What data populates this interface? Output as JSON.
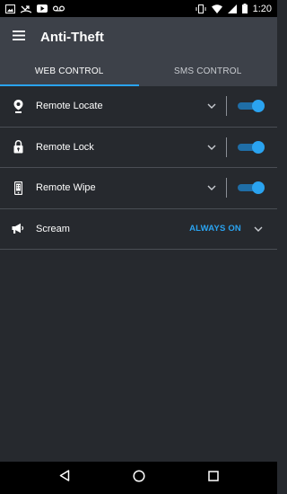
{
  "status_bar": {
    "time": "1:20",
    "left_icons": [
      "image-icon",
      "missed-call-icon",
      "youtube-icon",
      "voicemail-icon"
    ],
    "right_icons": [
      "vibrate-icon",
      "wifi-icon",
      "signal-icon",
      "battery-icon"
    ]
  },
  "app_bar": {
    "title": "Anti-Theft"
  },
  "tabs": [
    {
      "label": "WEB CONTROL",
      "active": true
    },
    {
      "label": "SMS CONTROL",
      "active": false
    }
  ],
  "items": [
    {
      "label": "Remote Locate",
      "icon": "location-pin-icon",
      "enabled": true
    },
    {
      "label": "Remote Lock",
      "icon": "lock-icon",
      "enabled": true
    },
    {
      "label": "Remote Wipe",
      "icon": "phone-wipe-icon",
      "enabled": true
    },
    {
      "label": "Scream",
      "icon": "megaphone-icon",
      "status": "ALWAYS ON"
    }
  ],
  "colors": {
    "accent": "#2aa3f0",
    "app_bar": "#3d4149",
    "background": "#26292e"
  }
}
